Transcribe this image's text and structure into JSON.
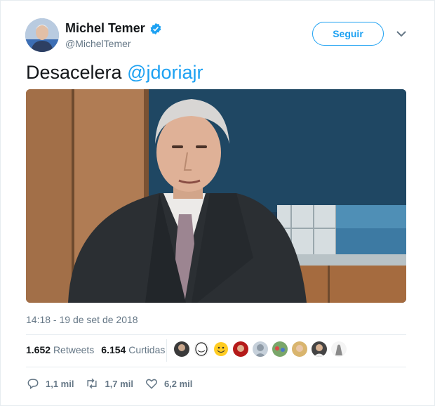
{
  "author": {
    "name": "Michel Temer",
    "handle": "@MichelTemer",
    "verified": true,
    "avatar_icon": "profile-photo"
  },
  "follow_label": "Seguir",
  "menu_icon": "chevron-down-icon",
  "tweet": {
    "text": "Desacelera ",
    "mention": "@jdoriajr"
  },
  "media": {
    "kind": "video-still"
  },
  "timestamp": "14:18 - 19 de set de 2018",
  "stats": {
    "retweets_count": "1.652",
    "retweets_label": "Retweets",
    "likes_count": "6.154",
    "likes_label": "Curtidas"
  },
  "likers_count_shown": 9,
  "actions": {
    "replies": "1,1 mil",
    "retweets": "1,7 mil",
    "likes": "6,2 mil"
  },
  "colors": {
    "accent": "#1da1f2",
    "secondary_text": "#657786",
    "primary_text": "#14171a"
  }
}
